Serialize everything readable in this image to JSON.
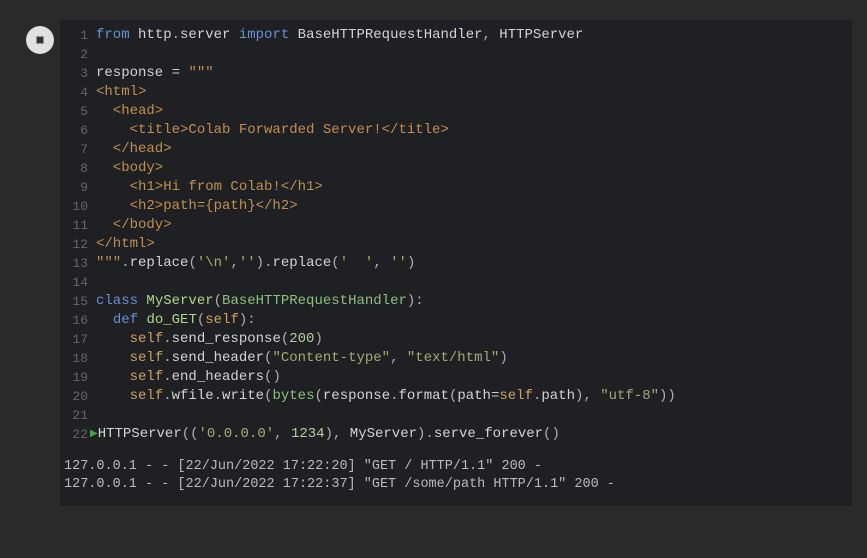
{
  "cell": {
    "running": true,
    "execution_arrow_line": 22,
    "lines": [
      {
        "n": 1,
        "tokens": [
          [
            "kw",
            "from"
          ],
          [
            "plain",
            " http"
          ],
          [
            "pun",
            "."
          ],
          [
            "plain",
            "server "
          ],
          [
            "kw",
            "import"
          ],
          [
            "plain",
            " BaseHTTPRequestHandler"
          ],
          [
            "pun",
            ","
          ],
          [
            "plain",
            " HTTPServer"
          ]
        ]
      },
      {
        "n": 2,
        "tokens": []
      },
      {
        "n": 3,
        "tokens": [
          [
            "plain",
            "response "
          ],
          [
            "op",
            "="
          ],
          [
            "plain",
            " "
          ],
          [
            "str",
            "\"\"\""
          ]
        ]
      },
      {
        "n": 4,
        "tokens": [
          [
            "str",
            "<html>"
          ]
        ]
      },
      {
        "n": 5,
        "tokens": [
          [
            "str",
            "  <head>"
          ]
        ]
      },
      {
        "n": 6,
        "tokens": [
          [
            "str",
            "    <title>Colab Forwarded Server!</title>"
          ]
        ]
      },
      {
        "n": 7,
        "tokens": [
          [
            "str",
            "  </head>"
          ]
        ]
      },
      {
        "n": 8,
        "tokens": [
          [
            "str",
            "  <body>"
          ]
        ]
      },
      {
        "n": 9,
        "tokens": [
          [
            "str",
            "    <h1>Hi from Colab!</h1>"
          ]
        ]
      },
      {
        "n": 10,
        "tokens": [
          [
            "str",
            "    <h2>path={path}</h2>"
          ]
        ]
      },
      {
        "n": 11,
        "tokens": [
          [
            "str",
            "  </body>"
          ]
        ]
      },
      {
        "n": 12,
        "tokens": [
          [
            "str",
            "</html>"
          ]
        ]
      },
      {
        "n": 13,
        "tokens": [
          [
            "str",
            "\"\"\""
          ],
          [
            "pun",
            "."
          ],
          [
            "plain",
            "replace"
          ],
          [
            "pun",
            "("
          ],
          [
            "strlit",
            "'\\n'"
          ],
          [
            "pun",
            ","
          ],
          [
            "strlit",
            "''"
          ],
          [
            "pun",
            ")"
          ],
          [
            "pun",
            "."
          ],
          [
            "plain",
            "replace"
          ],
          [
            "pun",
            "("
          ],
          [
            "strlit",
            "'  '"
          ],
          [
            "pun",
            ","
          ],
          [
            "plain",
            " "
          ],
          [
            "strlit",
            "''"
          ],
          [
            "pun",
            ")"
          ]
        ]
      },
      {
        "n": 14,
        "tokens": []
      },
      {
        "n": 15,
        "tokens": [
          [
            "kw",
            "class"
          ],
          [
            "plain",
            " "
          ],
          [
            "fn",
            "MyServer"
          ],
          [
            "pun",
            "("
          ],
          [
            "cls",
            "BaseHTTPRequestHandler"
          ],
          [
            "pun",
            ")"
          ],
          [
            "pun",
            ":"
          ]
        ]
      },
      {
        "n": 16,
        "tokens": [
          [
            "plain",
            "  "
          ],
          [
            "kw",
            "def"
          ],
          [
            "plain",
            " "
          ],
          [
            "fn",
            "do_GET"
          ],
          [
            "pun",
            "("
          ],
          [
            "self",
            "self"
          ],
          [
            "pun",
            ")"
          ],
          [
            "pun",
            ":"
          ]
        ]
      },
      {
        "n": 17,
        "tokens": [
          [
            "plain",
            "    "
          ],
          [
            "self",
            "self"
          ],
          [
            "pun",
            "."
          ],
          [
            "plain",
            "send_response"
          ],
          [
            "pun",
            "("
          ],
          [
            "num",
            "200"
          ],
          [
            "pun",
            ")"
          ]
        ]
      },
      {
        "n": 18,
        "tokens": [
          [
            "plain",
            "    "
          ],
          [
            "self",
            "self"
          ],
          [
            "pun",
            "."
          ],
          [
            "plain",
            "send_header"
          ],
          [
            "pun",
            "("
          ],
          [
            "strlit",
            "\"Content-type\""
          ],
          [
            "pun",
            ","
          ],
          [
            "plain",
            " "
          ],
          [
            "strlit",
            "\"text/html\""
          ],
          [
            "pun",
            ")"
          ]
        ]
      },
      {
        "n": 19,
        "tokens": [
          [
            "plain",
            "    "
          ],
          [
            "self",
            "self"
          ],
          [
            "pun",
            "."
          ],
          [
            "plain",
            "end_headers"
          ],
          [
            "pun",
            "("
          ],
          [
            "pun",
            ")"
          ]
        ]
      },
      {
        "n": 20,
        "tokens": [
          [
            "plain",
            "    "
          ],
          [
            "self",
            "self"
          ],
          [
            "pun",
            "."
          ],
          [
            "plain",
            "wfile"
          ],
          [
            "pun",
            "."
          ],
          [
            "plain",
            "write"
          ],
          [
            "pun",
            "("
          ],
          [
            "builtin",
            "bytes"
          ],
          [
            "pun",
            "("
          ],
          [
            "plain",
            "response"
          ],
          [
            "pun",
            "."
          ],
          [
            "plain",
            "format"
          ],
          [
            "pun",
            "("
          ],
          [
            "plain",
            "path"
          ],
          [
            "op",
            "="
          ],
          [
            "self",
            "self"
          ],
          [
            "pun",
            "."
          ],
          [
            "plain",
            "path"
          ],
          [
            "pun",
            ")"
          ],
          [
            "pun",
            ","
          ],
          [
            "plain",
            " "
          ],
          [
            "strlit",
            "\"utf-8\""
          ],
          [
            "pun",
            ")"
          ],
          [
            "pun",
            ")"
          ]
        ]
      },
      {
        "n": 21,
        "tokens": []
      },
      {
        "n": 22,
        "tokens": [
          [
            "plain",
            "HTTPServer"
          ],
          [
            "pun",
            "("
          ],
          [
            "pun",
            "("
          ],
          [
            "strlit",
            "'0.0.0.0'"
          ],
          [
            "pun",
            ","
          ],
          [
            "plain",
            " "
          ],
          [
            "num",
            "1234"
          ],
          [
            "pun",
            ")"
          ],
          [
            "pun",
            ","
          ],
          [
            "plain",
            " MyServer"
          ],
          [
            "pun",
            ")"
          ],
          [
            "pun",
            "."
          ],
          [
            "plain",
            "serve_forever"
          ],
          [
            "pun",
            "("
          ],
          [
            "pun",
            ")"
          ]
        ]
      }
    ]
  },
  "output": [
    "127.0.0.1 - - [22/Jun/2022 17:22:20] \"GET / HTTP/1.1\" 200 -",
    "127.0.0.1 - - [22/Jun/2022 17:22:37] \"GET /some/path HTTP/1.1\" 200 -"
  ]
}
